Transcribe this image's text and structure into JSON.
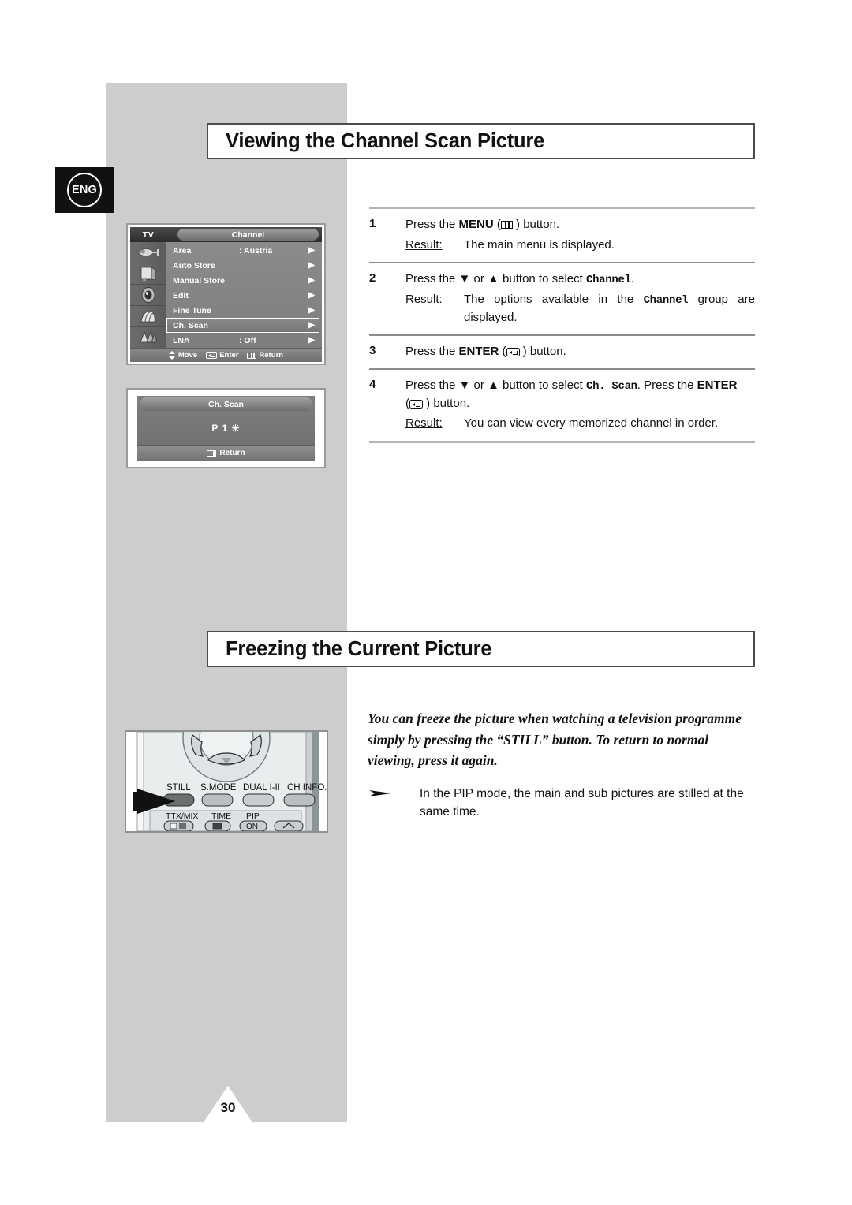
{
  "page": {
    "language_badge": "ENG",
    "page_number": "30"
  },
  "sections": [
    {
      "id": "channel-scan",
      "heading": "Viewing the Channel Scan Picture"
    },
    {
      "id": "freezing",
      "heading": "Freezing the Current Picture"
    }
  ],
  "osd_main": {
    "source_label": "TV",
    "menu_title": "Channel",
    "rows": [
      {
        "label": "Area",
        "value": ": Austria",
        "arrow": "▶",
        "selected": false
      },
      {
        "label": "Auto Store",
        "value": "",
        "arrow": "▶",
        "selected": false
      },
      {
        "label": "Manual Store",
        "value": "",
        "arrow": "▶",
        "selected": false
      },
      {
        "label": "Edit",
        "value": "",
        "arrow": "▶",
        "selected": false
      },
      {
        "label": "Fine Tune",
        "value": "",
        "arrow": "▶",
        "selected": false
      },
      {
        "label": "Ch. Scan",
        "value": "",
        "arrow": "▶",
        "selected": true
      },
      {
        "label": "LNA",
        "value": ": Off",
        "arrow": "▶",
        "selected": false
      }
    ],
    "footer": {
      "move": "Move",
      "enter": "Enter",
      "return": "Return"
    },
    "icons": [
      "antenna-icon",
      "picture-icon",
      "sound-icon",
      "feature-icon",
      "setup-icon"
    ]
  },
  "osd_scan": {
    "title": "Ch. Scan",
    "channel": "P 1 ✳",
    "footer_return": "Return"
  },
  "steps": [
    {
      "number": "1",
      "text_before": "Press the ",
      "keyword": "MENU",
      "icon": "menu-icon",
      "text_after": " ) button.",
      "result_label": "Result:",
      "result_text": "The main menu is displayed."
    },
    {
      "number": "2",
      "text_before": "Press the ▼ or ▲ button to select ",
      "keyword_mono": "Channel",
      "text_after": ".",
      "result_label": "Result:",
      "result_text_a": "The options available in the ",
      "result_mono": "Channel",
      "result_text_b": " group are displayed."
    },
    {
      "number": "3",
      "text_before": "Press the ",
      "keyword": "ENTER",
      "icon": "enter-icon",
      "text_after": " ) button."
    },
    {
      "number": "4",
      "text_before": "Press the ▼ or ▲ button to select ",
      "keyword_mono": "Ch. Scan",
      "text_mid": ". Press the ",
      "keyword": "ENTER",
      "icon": "enter-icon",
      "text_after": " ) button.",
      "result_label": "Result:",
      "result_text": "You can view every memorized channel in order."
    }
  ],
  "freezing": {
    "intro": "You can freeze the picture when watching a television programme simply by pressing the “STILL” button. To return to normal viewing, press it again.",
    "bullet_marker": "➤",
    "bullet_text": "In the PIP mode, the main and sub pictures are stilled at the same time."
  },
  "remote": {
    "row1_labels": [
      "STILL",
      "S.MODE",
      "DUAL I-Ⅱ",
      "CH INFO."
    ],
    "row2_labels": [
      "TTX/MIX",
      "TIME",
      "PIP",
      ""
    ],
    "pip_button_text": "ON",
    "highlighted_button": "STILL"
  },
  "colors": {
    "band_gray": "#cdcdcd",
    "heading_border": "#4c4c4c",
    "badge_black": "#111111",
    "osd_gray": "#7c7c7c"
  }
}
